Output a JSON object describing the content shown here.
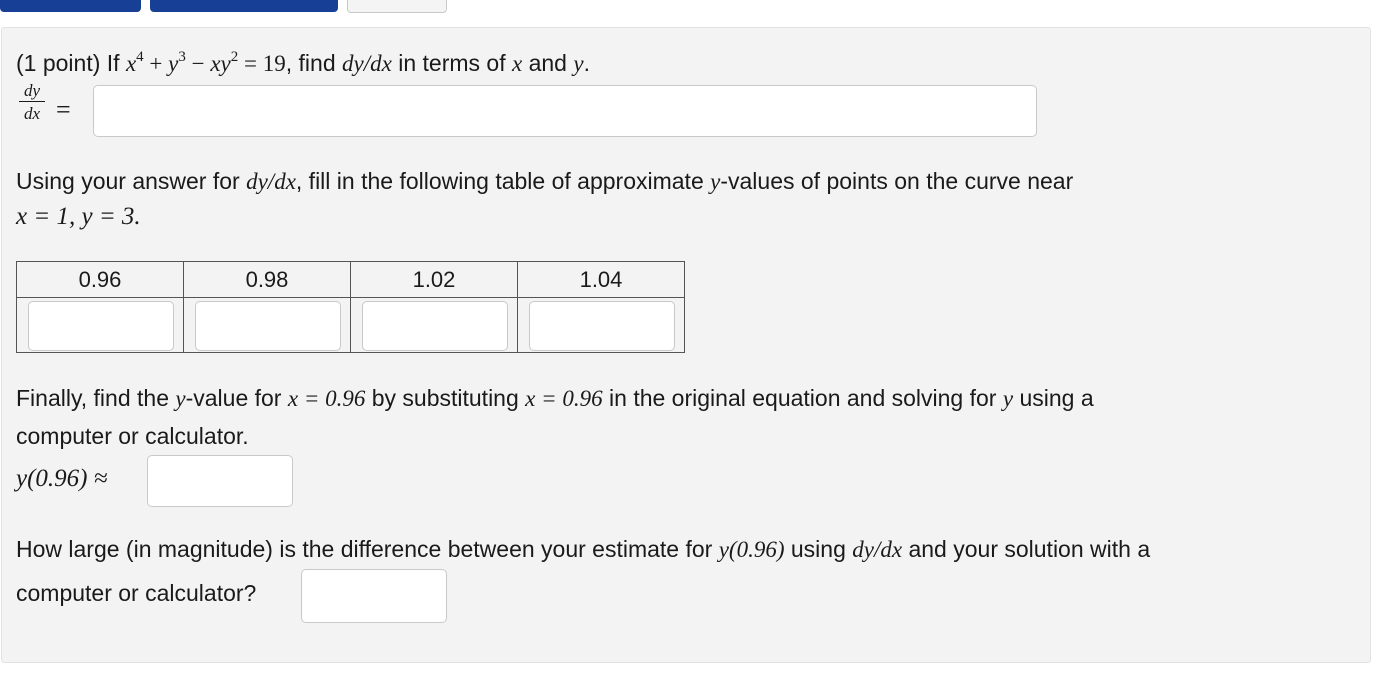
{
  "problem": {
    "intro_prefix": "(1 point) If ",
    "find_text": ", find ",
    "in_terms_text": " in terms of ",
    "and_text": " and ",
    "period": ".",
    "dydx_label": {
      "num": "dy",
      "den": "dx"
    },
    "equals": "=",
    "using_prefix": "Using your answer for ",
    "using_suffix": ", fill in the following table of approximate ",
    "y_values_text": "-values of points on the curve near",
    "point_text": "x = 1, y = 3.",
    "table": {
      "headers": [
        "0.96",
        "0.98",
        "1.02",
        "1.04"
      ]
    },
    "finally_prefix": "Finally, find the ",
    "finally_mid1": "-value for ",
    "finally_mid2": " by substituting ",
    "finally_mid3": " in the original equation and solving for ",
    "finally_suffix": " using a",
    "finally_line2": "computer or calculator.",
    "y096_label": "y(0.96) ≈",
    "how_large_prefix": "How large (in magnitude) is the difference between your estimate for ",
    "how_large_mid": " using ",
    "how_large_suffix": " and your solution with a",
    "how_large_line2": "computer or calculator?",
    "var_x": "x",
    "var_y": "y",
    "dydx": "dy/dx",
    "x_eq_096": "x = 0.96",
    "y_096": "y(0.96)",
    "num_19": "19"
  }
}
